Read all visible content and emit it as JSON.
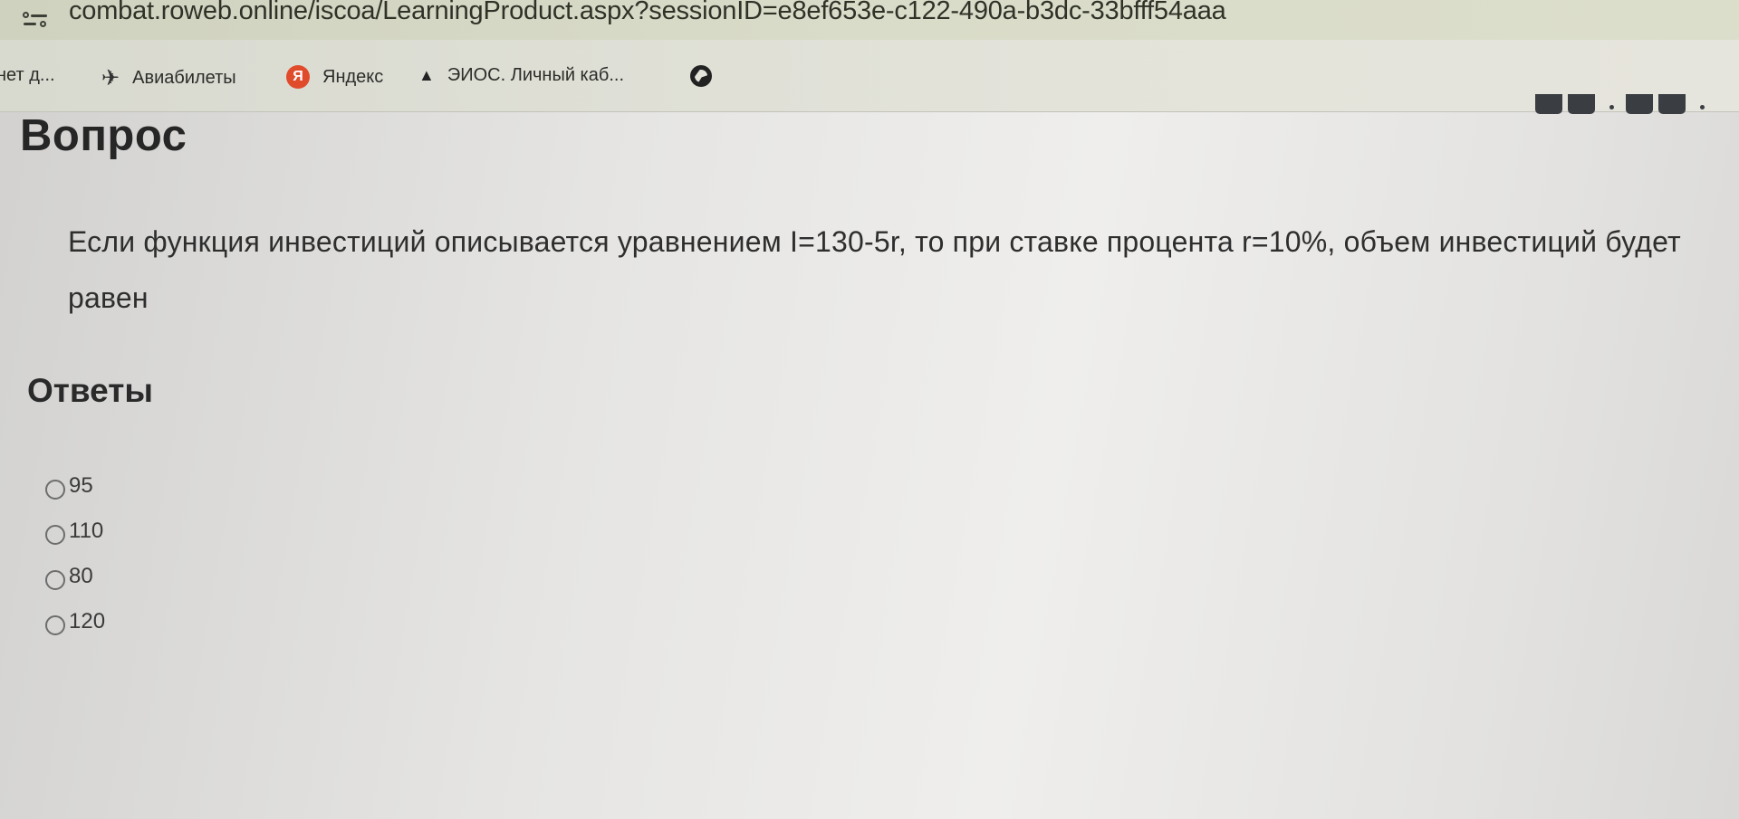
{
  "browser": {
    "url": "combat.roweb.online/iscoa/LearningProduct.aspx?sessionID=e8ef653e-c122-490a-b3dc-33bfff54aaa",
    "bookmarks": [
      {
        "label": "нет д...",
        "icon": "none"
      },
      {
        "label": "Авиабилеты",
        "icon": "plane-icon"
      },
      {
        "label": "Яндекс",
        "icon": "yandex-icon"
      },
      {
        "label": "ЭИОС. Личный каб...",
        "icon": "graduation-cap-icon"
      },
      {
        "label": "",
        "icon": "globe-icon"
      }
    ]
  },
  "question": {
    "heading": "Вопрос",
    "text": "Если функция инвестиций описывается уравнением I=130-5r, то при ставке процента r=10%, объем инвестиций будет равен"
  },
  "answers": {
    "heading": "Ответы",
    "options": [
      {
        "label": "95",
        "selected": false
      },
      {
        "label": "110",
        "selected": false
      },
      {
        "label": "80",
        "selected": false
      },
      {
        "label": "120",
        "selected": false
      }
    ]
  },
  "icons": {
    "yandex_letter": "Я"
  },
  "colors": {
    "yandex": "#e04b2b",
    "timer_box": "#3a3d42"
  }
}
